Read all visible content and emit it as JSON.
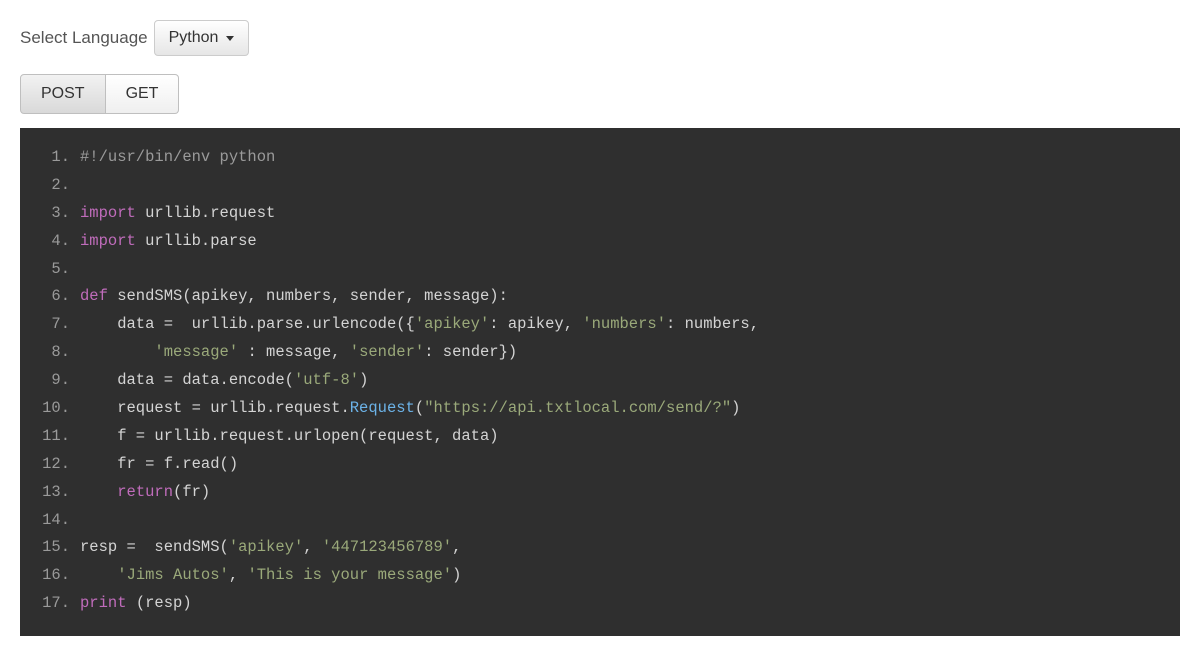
{
  "lang_select": {
    "label": "Select Language",
    "selected": "Python"
  },
  "tabs": {
    "post": "POST",
    "get": "GET",
    "active": "post"
  },
  "code_lines": [
    "#!/usr/bin/env python",
    "",
    "import urllib.request",
    "import urllib.parse",
    "",
    "def sendSMS(apikey, numbers, sender, message):",
    "    data =  urllib.parse.urlencode({'apikey': apikey, 'numbers': numbers,",
    "        'message' : message, 'sender': sender})",
    "    data = data.encode('utf-8')",
    "    request = urllib.request.Request(\"https://api.txtlocal.com/send/?\")",
    "    f = urllib.request.urlopen(request, data)",
    "    fr = f.read()",
    "    return(fr)",
    "",
    "resp =  sendSMS('apikey', '447123456789',",
    "    'Jims Autos', 'This is your message')",
    "print (resp)"
  ]
}
